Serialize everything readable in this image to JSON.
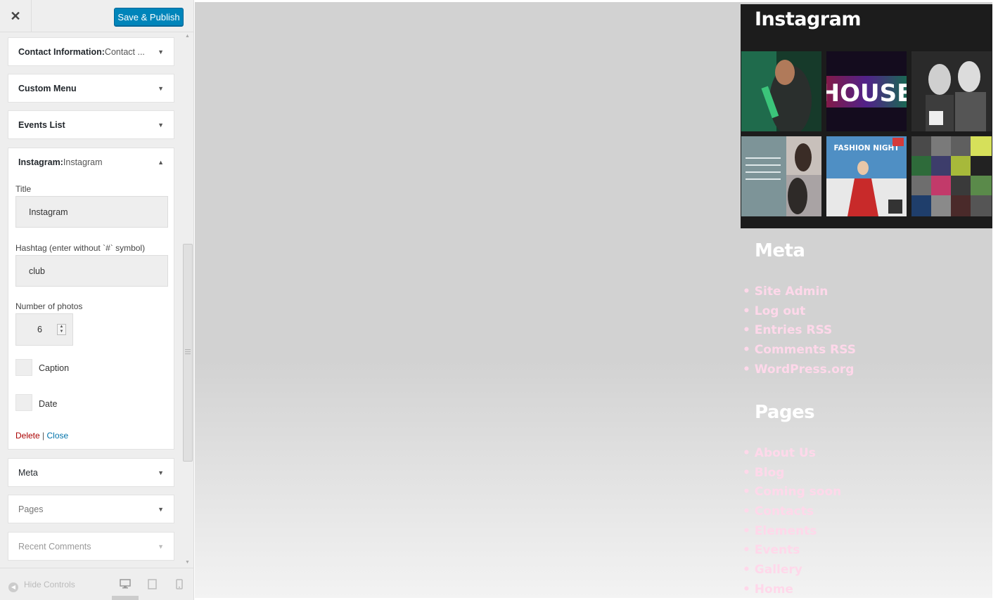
{
  "header": {
    "close_symbol": "✕",
    "save_label": "Save & Publish"
  },
  "sections": {
    "contact": {
      "title": "Contact Information:",
      "sub": " Contact ..."
    },
    "custom_menu": {
      "title": "Custom Menu"
    },
    "events": {
      "title": "Events List"
    },
    "instagram": {
      "title": "Instagram:",
      "sub": " Instagram"
    },
    "meta": {
      "title": "Meta"
    },
    "pages": {
      "title": "Pages"
    },
    "recent_comments": {
      "title": "Recent Comments"
    }
  },
  "form": {
    "title_label": "Title",
    "title_value": "Instagram",
    "hashtag_label": "Hashtag (enter without `#` symbol)",
    "hashtag_value": "club",
    "photos_label": "Number of photos",
    "photos_value": "6",
    "caption_label": "Caption",
    "date_label": "Date",
    "delete_label": "Delete",
    "separator": " | ",
    "close_label": "Close"
  },
  "footer": {
    "hide_controls": "Hide Controls"
  },
  "preview": {
    "instagram_title": "Instagram",
    "photos": [
      {
        "name": "green-bottle-photo",
        "label": ""
      },
      {
        "name": "house-neon-photo",
        "label": "HOUSE"
      },
      {
        "name": "two-women-bw-photo",
        "label": ""
      },
      {
        "name": "hair-salon-collage-photo",
        "label": ""
      },
      {
        "name": "fashion-night-poster-photo",
        "label": "FASHION NIGHT"
      },
      {
        "name": "dj-lineup-collage-photo",
        "label": ""
      }
    ],
    "meta": {
      "title": "Meta",
      "links": [
        "• Site Admin",
        "• Log out",
        "• Entries RSS",
        "• Comments RSS",
        "• WordPress.org"
      ]
    },
    "pages": {
      "title": "Pages",
      "links": [
        "• About Us",
        "• Blog",
        "• Coming soon",
        "• Contacts",
        "• Elements",
        "• Events",
        "• Gallery",
        "• Home"
      ]
    }
  }
}
